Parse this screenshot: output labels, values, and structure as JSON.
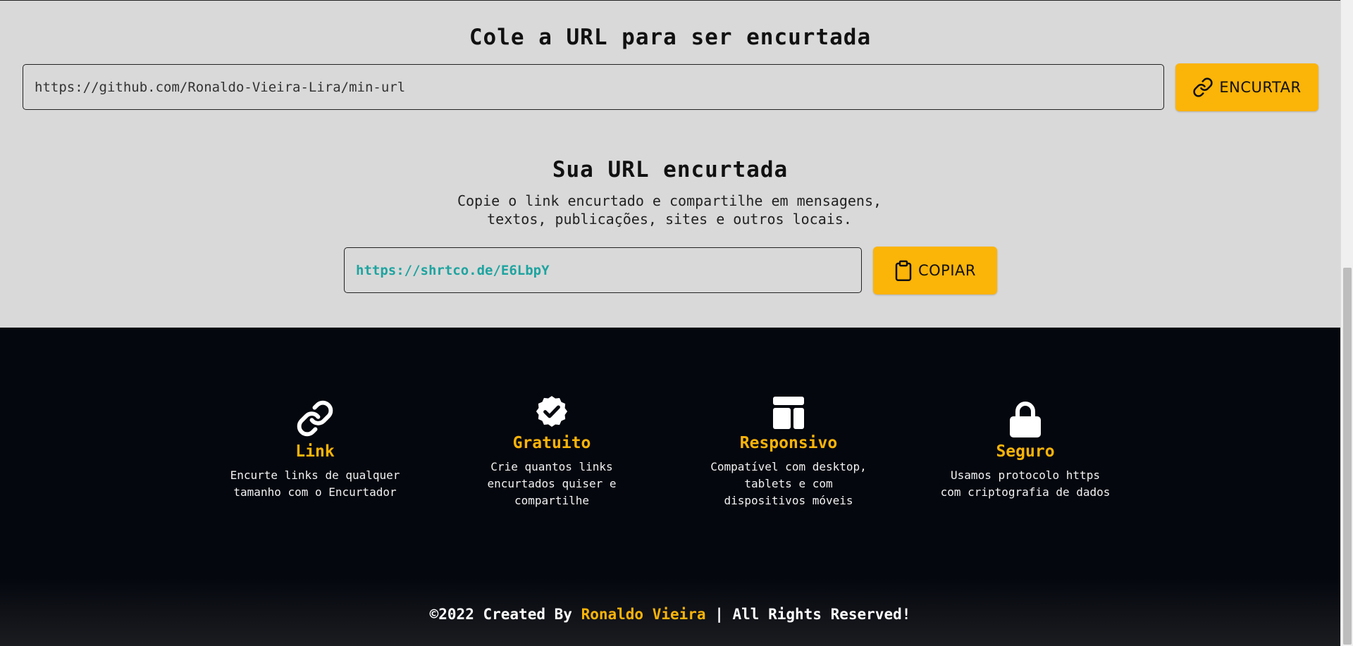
{
  "shorten": {
    "title": "Cole a URL para ser encurtada",
    "url_value": "https://github.com/Ronaldo-Vieira-Lira/min-url",
    "button_label": "ENCURTAR"
  },
  "result": {
    "title": "Sua URL encurtada",
    "desc_line1": "Copie o link encurtado e compartilhe em mensagens,",
    "desc_line2": "textos, publicações, sites e outros locais.",
    "short_value": "https://shrtco.de/E6LbpY",
    "button_label": "COPIAR"
  },
  "features": [
    {
      "icon": "link-icon",
      "title": "Link",
      "line1": "Encurte links de qualquer",
      "line2": "tamanho com o Encurtador",
      "line3": ""
    },
    {
      "icon": "badge-check-icon",
      "title": "Gratuito",
      "line1": "Crie quantos links",
      "line2": "encurtados quiser e",
      "line3": "compartilhe"
    },
    {
      "icon": "layout-icon",
      "title": "Responsivo",
      "line1": "Compatível com desktop,",
      "line2": "tablets e com",
      "line3": "dispositivos móveis"
    },
    {
      "icon": "lock-icon",
      "title": "Seguro",
      "line1": "Usamos protocolo https",
      "line2": "com criptografia de dados",
      "line3": ""
    }
  ],
  "footer": {
    "prefix": "©2022 Created By ",
    "author": "Ronaldo Vieira",
    "suffix": " | All Rights Reserved!"
  },
  "colors": {
    "accent": "#fbb408",
    "link": "#1ea4a0",
    "dark": "#04070e",
    "light": "#d9d9d9"
  }
}
